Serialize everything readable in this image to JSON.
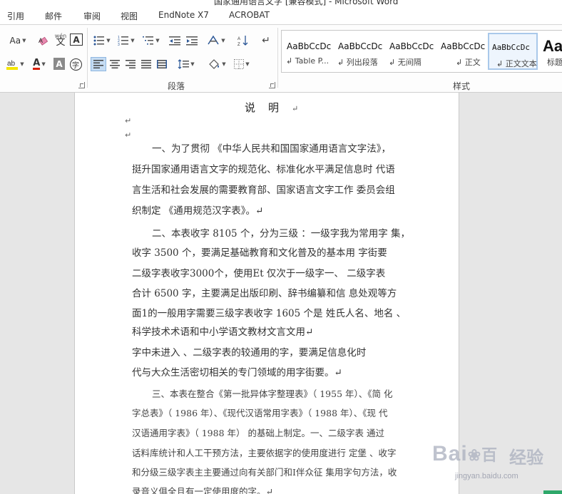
{
  "window": {
    "title_fragment": "国家通用语言文字 [兼容模式] - Microsoft Word"
  },
  "menu": {
    "tabs": [
      "引用",
      "邮件",
      "审阅",
      "视图",
      "EndNote X7",
      "ACROBAT"
    ]
  },
  "ribbon": {
    "font_group": {
      "change_case_label": "Aa",
      "phonetic_label": "wén",
      "char_border_label": "A",
      "font_color_label": "A",
      "char_shading_label": "A",
      "enclose_char_label": "字"
    },
    "paragraph_group": {
      "label": "段落"
    },
    "styles_group": {
      "label": "样式",
      "items": [
        {
          "sample": "AaBbCcDc",
          "name": "Table P..."
        },
        {
          "sample": "AaBbCcDc",
          "name": "列出段落"
        },
        {
          "sample": "AaBbCcDc",
          "name": "无间隔"
        },
        {
          "sample": "AaBbCcDc",
          "name": "正文"
        },
        {
          "sample": "AaBbCcDc",
          "name": "正文文本"
        },
        {
          "sample": "Aa",
          "name": "标题"
        }
      ],
      "selected_index": 4
    },
    "colors": {
      "highlight": "#f5e600",
      "font_color": "#d81e06",
      "selection": "#c5dcf3"
    }
  },
  "document": {
    "title": "说明",
    "paragraph_mark": "↵",
    "lines": [
      "一、为了贯彻 《中华人民共和国国家通用语言文字法》，",
      "挺升国家通用语言文字的规范化、标准化水平满足信息时  代语",
      "言生活和社会发展的需要教育部、国家语言文字工作  委员会组",
      "织制定  《通用规范汉字表》。↵",
      "二、本表收字  8105   个，分为三级 ：一级字我为常用字  集，",
      "收字   3500  个，要满足基础教育和文化普及的基本用  字街要",
      "二级字表收字3000个，使用Et 仅次于一级字一、  二级字表",
      "合计  6500 字，主要满足出版印刷、辞书编纂和信  息处观等方",
      "面1的一般用字需要三级字表收字  1605 个是 姓氏人名、地名 、",
      "科学技术术语和中小学语文教材文言文用↵",
      "字中未进入    、二级字表的较通用的字，要满足信息化时",
      "代与大众生活密切相关的专门领域的用字街要。↵",
      "三、本表在整合《第一批异体字整理表》（ 1955 年）、《简  化",
      "字总表》（  1986 年）、《现代汉语常用字表》（  1988 年）、《现  代",
      "汉语通用字表》（   1988    年）   的基础上制定。一、二级字表   通过",
      "话料库统计和人工干预方法，主要依据字的使用度进行  定堡  、收字",
      "和分级三级字表主主要通过向有关部门和I伴众征  集用字句方法，收",
      "录音义俱全且有一定使用度的字。↵"
    ]
  },
  "watermark": {
    "logo_text": "Bai",
    "logo_suffix": "百",
    "cn_text": "经验",
    "url": "jingyan.baidu.com"
  }
}
